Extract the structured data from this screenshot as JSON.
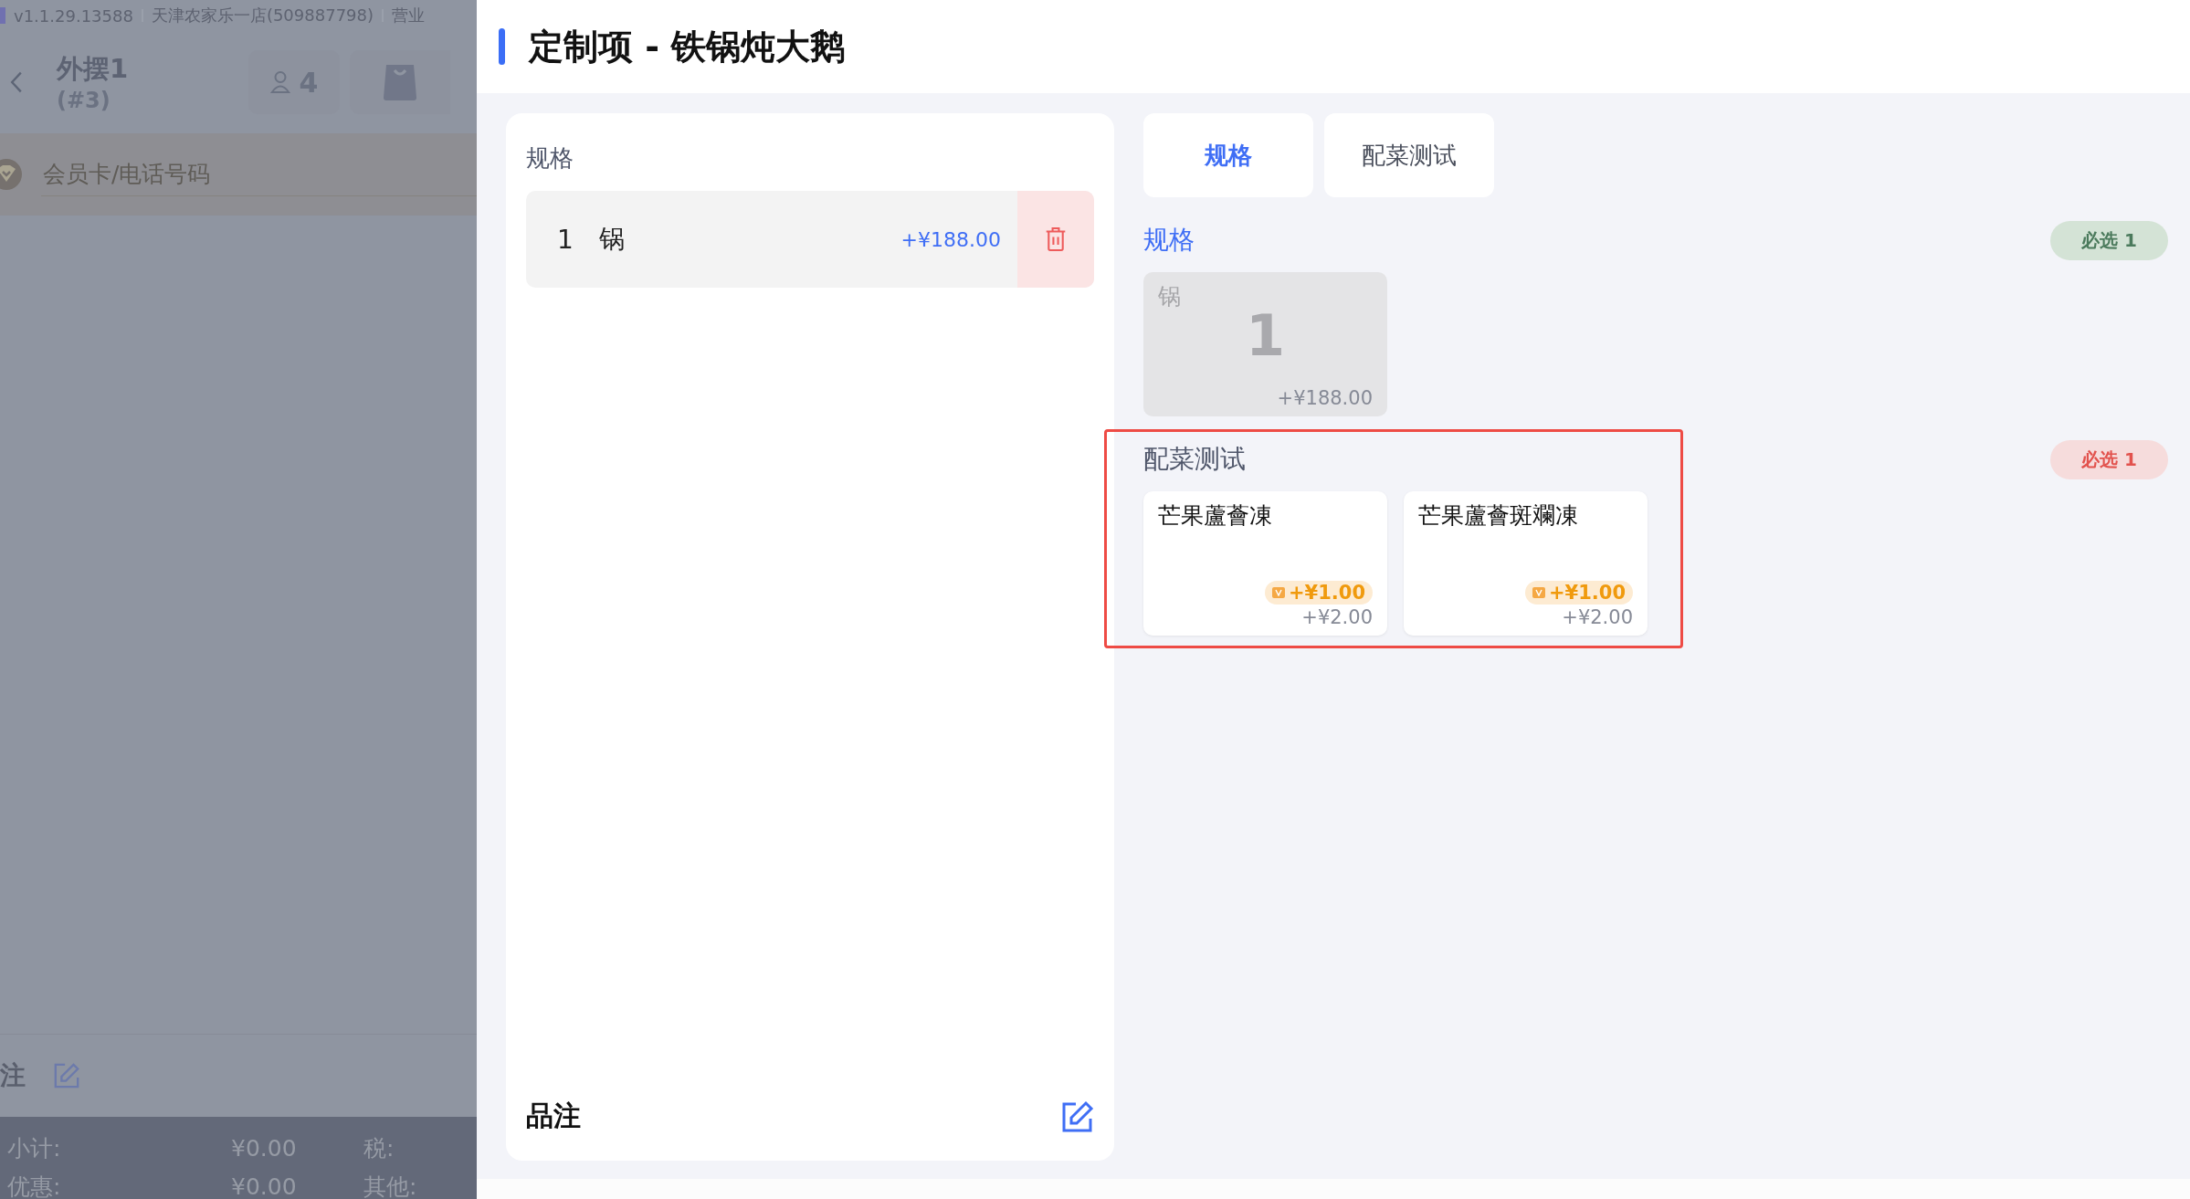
{
  "background": {
    "status_bar": {
      "version": "v1.1.29.13588",
      "store": "天津农家乐一店(509887798)",
      "business_day": "营业"
    },
    "order": {
      "table": "外摆1",
      "number": "(#3)",
      "guests": "4"
    },
    "member_field": {
      "placeholder": "会员卡/电话号码"
    },
    "remark": {
      "label": "注"
    },
    "summary": [
      {
        "label": "小计:",
        "value": "¥0.00",
        "label_2": "税:"
      },
      {
        "label": "优惠:",
        "value": "¥0.00",
        "label_2": "其他:"
      }
    ]
  },
  "dialog": {
    "title": "定制项 - 铁锅炖大鹅",
    "chosen": {
      "heading": "规格",
      "items": [
        {
          "count": "1",
          "name": "锅",
          "price": "+¥188.00"
        }
      ],
      "note_label": "品注"
    },
    "tabs": [
      {
        "label": "规格",
        "selected": true
      },
      {
        "label": "配菜测试",
        "selected": false
      }
    ],
    "groups": [
      {
        "title": "规格",
        "active": true,
        "badge": "必选 1",
        "satisfied": true,
        "highlighted": false,
        "options": [
          {
            "name": "锅",
            "count": "1",
            "price": "+¥188.00",
            "selected": true
          }
        ]
      },
      {
        "title": "配菜测试",
        "active": false,
        "badge": "必选 1",
        "satisfied": false,
        "highlighted": true,
        "options": [
          {
            "name": "芒果蘆薈凍",
            "member_price": "+¥1.00",
            "price": "+¥2.00",
            "selected": false
          },
          {
            "name": "芒果蘆薈斑斕凍",
            "member_price": "+¥1.00",
            "price": "+¥2.00",
            "selected": false
          }
        ]
      }
    ]
  }
}
